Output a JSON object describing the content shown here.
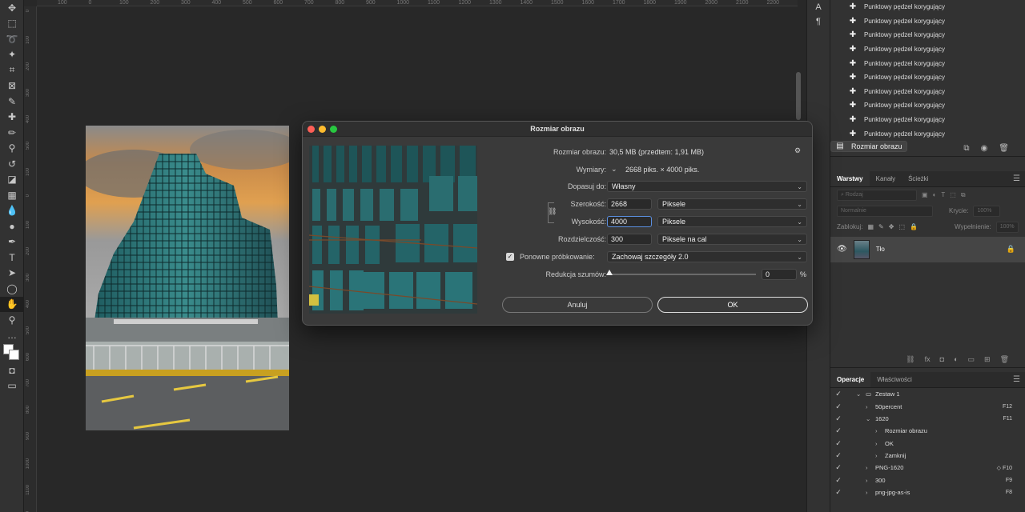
{
  "window": {
    "lights": [
      "#ff5f57",
      "#febc2e",
      "#28c840"
    ]
  },
  "rulers": {
    "h_ticks": [
      "100",
      "0",
      "100",
      "200",
      "300",
      "400",
      "500",
      "600",
      "700",
      "800",
      "900",
      "1000",
      "1100",
      "1200",
      "1300",
      "1400",
      "1500",
      "1600",
      "1700",
      "1800",
      "1900",
      "2000",
      "2100",
      "2200",
      "23"
    ],
    "v_ticks": [
      "0",
      "100",
      "200",
      "300",
      "400",
      "500",
      "100",
      "0",
      "100",
      "200",
      "300",
      "400",
      "500",
      "600",
      "700",
      "800",
      "900",
      "1000",
      "1100",
      "1200"
    ]
  },
  "dialog": {
    "title": "Rozmiar obrazu",
    "image_size_label": "Rozmiar obrazu:",
    "image_size_value": "30,5 MB (przedtem: 1,91 MB)",
    "dimensions_label": "Wymiary:",
    "dimensions_value": "2668 piks. × 4000 piks.",
    "fit_to_label": "Dopasuj do:",
    "fit_to_value": "Własny",
    "width_label": "Szerokość:",
    "width_value": "2668",
    "width_unit": "Piksele",
    "height_label": "Wysokość:",
    "height_value": "4000",
    "height_unit": "Piksele",
    "resolution_label": "Rozdzielczość:",
    "resolution_value": "300",
    "resolution_unit": "Piksele na cal",
    "resample_label": "Ponowne próbkowanie:",
    "resample_checked": true,
    "resample_value": "Zachowaj szczegóły 2.0",
    "noise_label": "Redukcja szumów:",
    "noise_value": "0",
    "noise_unit": "%",
    "cancel_label": "Anuluj",
    "ok_label": "OK"
  },
  "history": {
    "items": [
      {
        "label": "Punktowy pędzel korygujący",
        "icon": "bandage-icon"
      },
      {
        "label": "Punktowy pędzel korygujący",
        "icon": "bandage-icon"
      },
      {
        "label": "Punktowy pędzel korygujący",
        "icon": "bandage-icon"
      },
      {
        "label": "Punktowy pędzel korygujący",
        "icon": "bandage-icon"
      },
      {
        "label": "Punktowy pędzel korygujący",
        "icon": "bandage-icon"
      },
      {
        "label": "Punktowy pędzel korygujący",
        "icon": "bandage-icon"
      },
      {
        "label": "Punktowy pędzel korygujący",
        "icon": "bandage-icon"
      },
      {
        "label": "Punktowy pędzel korygujący",
        "icon": "bandage-icon"
      },
      {
        "label": "Punktowy pędzel korygujący",
        "icon": "bandage-icon"
      },
      {
        "label": "Punktowy pędzel korygujący",
        "icon": "bandage-icon"
      },
      {
        "label": "Rozmiar obrazu",
        "icon": "document-icon"
      }
    ]
  },
  "layers_panel": {
    "tabs": [
      "Warstwy",
      "Kanały",
      "Ścieżki"
    ],
    "filter_placeholder": "Rodzaj",
    "blend_mode": "Normalnie",
    "opacity_label": "Krycie:",
    "opacity_value": "100%",
    "lock_label": "Zablokuj:",
    "fill_label": "Wypełnienie:",
    "fill_value": "100%",
    "layers": [
      {
        "name": "Tło"
      }
    ]
  },
  "actions_panel": {
    "tabs": [
      "Operacje",
      "Właściwości"
    ],
    "items": [
      {
        "indent": 1,
        "type": "folder",
        "label": "Zestaw 1",
        "key": ""
      },
      {
        "indent": 2,
        "type": "action",
        "label": "50percent",
        "key": "F12"
      },
      {
        "indent": 2,
        "type": "action-open",
        "label": "1620",
        "key": "F11"
      },
      {
        "indent": 3,
        "type": "step",
        "label": "Rozmiar obrazu",
        "key": ""
      },
      {
        "indent": 3,
        "type": "step",
        "label": "OK",
        "key": ""
      },
      {
        "indent": 3,
        "type": "step",
        "label": "Zamknij",
        "key": ""
      },
      {
        "indent": 2,
        "type": "action",
        "label": "PNG-1620",
        "key": "◇ F10"
      },
      {
        "indent": 2,
        "type": "action",
        "label": "300",
        "key": "F9"
      },
      {
        "indent": 2,
        "type": "action",
        "label": "png-jpg-as-is",
        "key": "F8"
      }
    ]
  }
}
